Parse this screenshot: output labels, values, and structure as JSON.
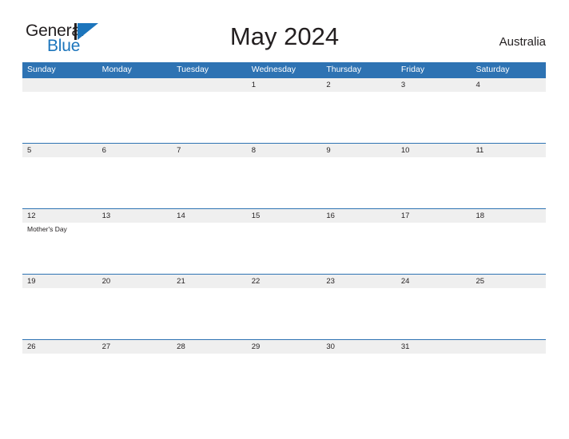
{
  "brand": {
    "word_one": "General",
    "word_two": "Blue",
    "mark_icon": "flag-triangle-icon"
  },
  "header": {
    "title": "May 2024",
    "locale": "Australia"
  },
  "calendar": {
    "weekdays": [
      "Sunday",
      "Monday",
      "Tuesday",
      "Wednesday",
      "Thursday",
      "Friday",
      "Saturday"
    ],
    "colors": {
      "header_blue": "#2E73B3",
      "date_strip_gray": "#EFEFEF",
      "brand_blue": "#1C75BC",
      "text_dark": "#231F20"
    },
    "weeks": [
      {
        "days": [
          {
            "number": "",
            "events": []
          },
          {
            "number": "",
            "events": []
          },
          {
            "number": "",
            "events": []
          },
          {
            "number": "1",
            "events": []
          },
          {
            "number": "2",
            "events": []
          },
          {
            "number": "3",
            "events": []
          },
          {
            "number": "4",
            "events": []
          }
        ]
      },
      {
        "days": [
          {
            "number": "5",
            "events": []
          },
          {
            "number": "6",
            "events": []
          },
          {
            "number": "7",
            "events": []
          },
          {
            "number": "8",
            "events": []
          },
          {
            "number": "9",
            "events": []
          },
          {
            "number": "10",
            "events": []
          },
          {
            "number": "11",
            "events": []
          }
        ]
      },
      {
        "days": [
          {
            "number": "12",
            "events": [
              "Mother's Day"
            ]
          },
          {
            "number": "13",
            "events": []
          },
          {
            "number": "14",
            "events": []
          },
          {
            "number": "15",
            "events": []
          },
          {
            "number": "16",
            "events": []
          },
          {
            "number": "17",
            "events": []
          },
          {
            "number": "18",
            "events": []
          }
        ]
      },
      {
        "days": [
          {
            "number": "19",
            "events": []
          },
          {
            "number": "20",
            "events": []
          },
          {
            "number": "21",
            "events": []
          },
          {
            "number": "22",
            "events": []
          },
          {
            "number": "23",
            "events": []
          },
          {
            "number": "24",
            "events": []
          },
          {
            "number": "25",
            "events": []
          }
        ]
      },
      {
        "days": [
          {
            "number": "26",
            "events": []
          },
          {
            "number": "27",
            "events": []
          },
          {
            "number": "28",
            "events": []
          },
          {
            "number": "29",
            "events": []
          },
          {
            "number": "30",
            "events": []
          },
          {
            "number": "31",
            "events": []
          },
          {
            "number": "",
            "events": []
          }
        ]
      }
    ]
  }
}
